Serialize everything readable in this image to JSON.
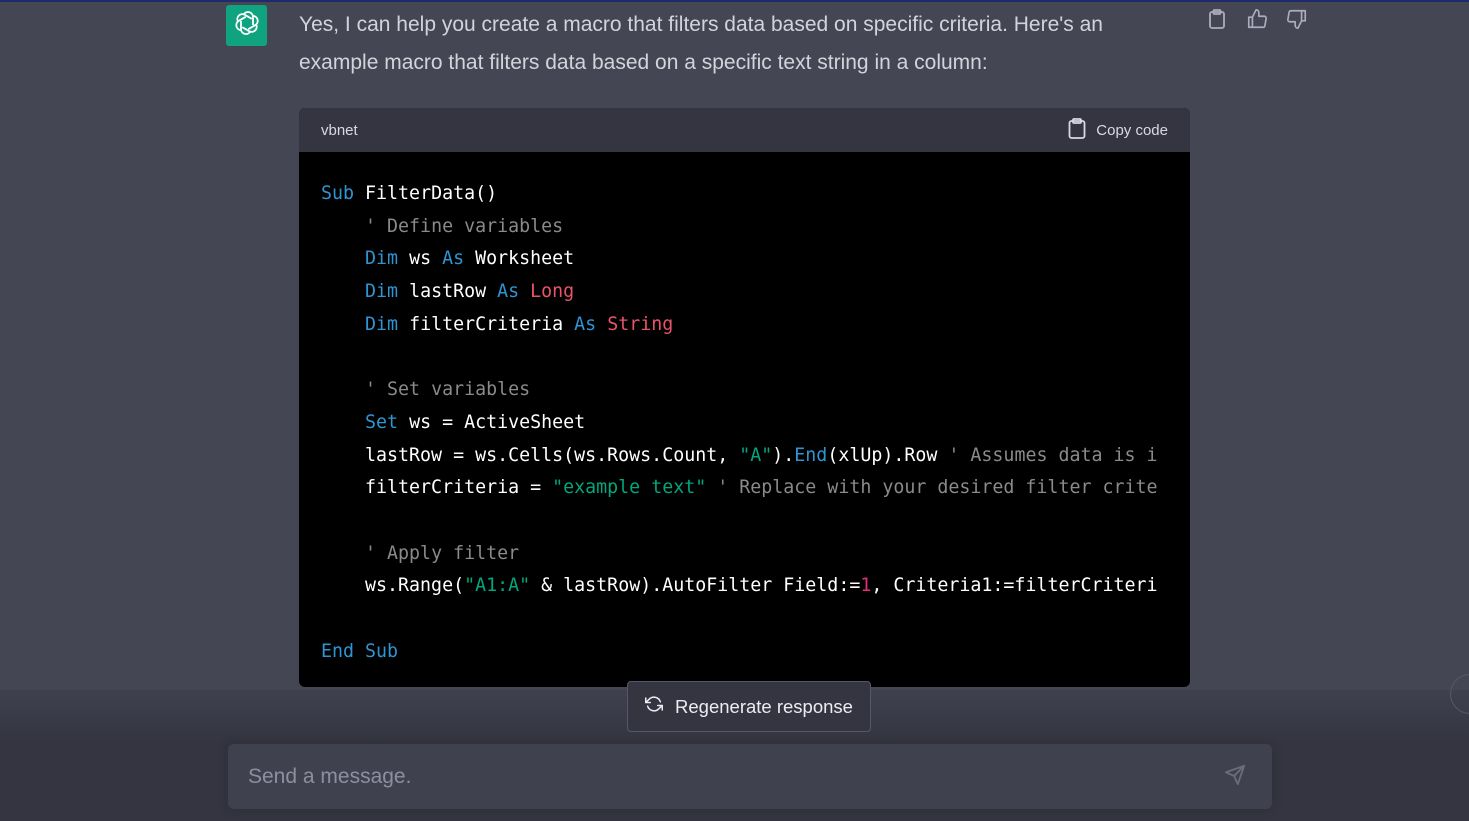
{
  "message": {
    "text": "Yes, I can help you create a macro that filters data based on specific criteria. Here's an example macro that filters data based on a specific text string in a column:"
  },
  "code_block": {
    "language": "vbnet",
    "copy_label": "Copy code",
    "lines": [
      [
        {
          "t": "Sub",
          "c": "kw"
        },
        {
          "t": " FilterData()"
        }
      ],
      [
        {
          "t": "    "
        },
        {
          "t": "' Define variables",
          "c": "cm"
        }
      ],
      [
        {
          "t": "    "
        },
        {
          "t": "Dim",
          "c": "kw"
        },
        {
          "t": " ws "
        },
        {
          "t": "As",
          "c": "kw"
        },
        {
          "t": " Worksheet"
        }
      ],
      [
        {
          "t": "    "
        },
        {
          "t": "Dim",
          "c": "kw"
        },
        {
          "t": " lastRow "
        },
        {
          "t": "As",
          "c": "kw"
        },
        {
          "t": " "
        },
        {
          "t": "Long",
          "c": "ty"
        }
      ],
      [
        {
          "t": "    "
        },
        {
          "t": "Dim",
          "c": "kw"
        },
        {
          "t": " filterCriteria "
        },
        {
          "t": "As",
          "c": "kw"
        },
        {
          "t": " "
        },
        {
          "t": "String",
          "c": "ty"
        }
      ],
      [],
      [
        {
          "t": "    "
        },
        {
          "t": "' Set variables",
          "c": "cm"
        }
      ],
      [
        {
          "t": "    "
        },
        {
          "t": "Set",
          "c": "kw"
        },
        {
          "t": " ws = ActiveSheet"
        }
      ],
      [
        {
          "t": "    lastRow = ws.Cells(ws.Rows.Count, "
        },
        {
          "t": "\"A\"",
          "c": "str"
        },
        {
          "t": ")."
        },
        {
          "t": "End",
          "c": "kw"
        },
        {
          "t": "(xlUp).Row "
        },
        {
          "t": "' Assumes data is i",
          "c": "cm"
        }
      ],
      [
        {
          "t": "    filterCriteria = "
        },
        {
          "t": "\"example text\"",
          "c": "str"
        },
        {
          "t": " "
        },
        {
          "t": "' Replace with your desired filter crite",
          "c": "cm"
        }
      ],
      [],
      [
        {
          "t": "    "
        },
        {
          "t": "' Apply filter",
          "c": "cm"
        }
      ],
      [
        {
          "t": "    ws.Range("
        },
        {
          "t": "\"A1:A\"",
          "c": "str"
        },
        {
          "t": " & lastRow).AutoFilter Field:="
        },
        {
          "t": "1",
          "c": "num"
        },
        {
          "t": ", Criteria1:=filterCriteri"
        }
      ],
      [],
      [
        {
          "t": "End",
          "c": "kw"
        },
        {
          "t": " "
        },
        {
          "t": "Sub",
          "c": "kw"
        }
      ]
    ]
  },
  "regenerate": {
    "label": "Regenerate response"
  },
  "composer": {
    "placeholder": "Send a message."
  },
  "icons": {
    "avatar": "openai-logo-icon",
    "copy": "clipboard-icon",
    "like": "thumbs-up-icon",
    "dislike": "thumbs-down-icon",
    "regenerate": "refresh-icon",
    "send": "send-icon"
  },
  "colors": {
    "background": "#444654",
    "avatar_bg": "#10a37f",
    "code_bg": "#000000",
    "code_header_bg": "#343541",
    "keyword": "#2e95d3",
    "type": "#e9546b",
    "string": "#00a67d",
    "comment": "#8a8a8a",
    "number": "#df3079"
  }
}
